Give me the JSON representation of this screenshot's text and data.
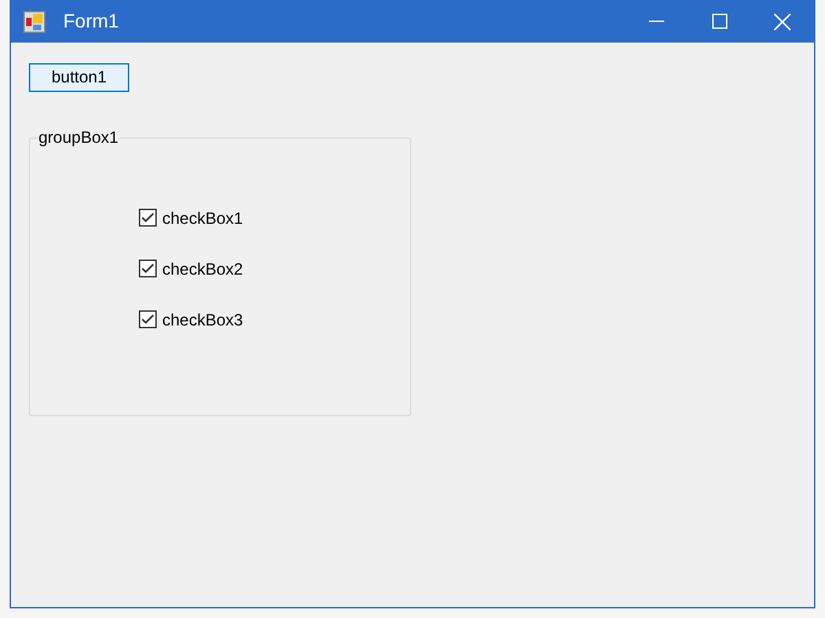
{
  "window": {
    "title": "Form1"
  },
  "button": {
    "label": "button1"
  },
  "group_box": {
    "title": "groupBox1",
    "checkboxes": [
      {
        "label": "checkBox1",
        "checked": true
      },
      {
        "label": "checkBox2",
        "checked": true
      },
      {
        "label": "checkBox3",
        "checked": true
      }
    ]
  }
}
